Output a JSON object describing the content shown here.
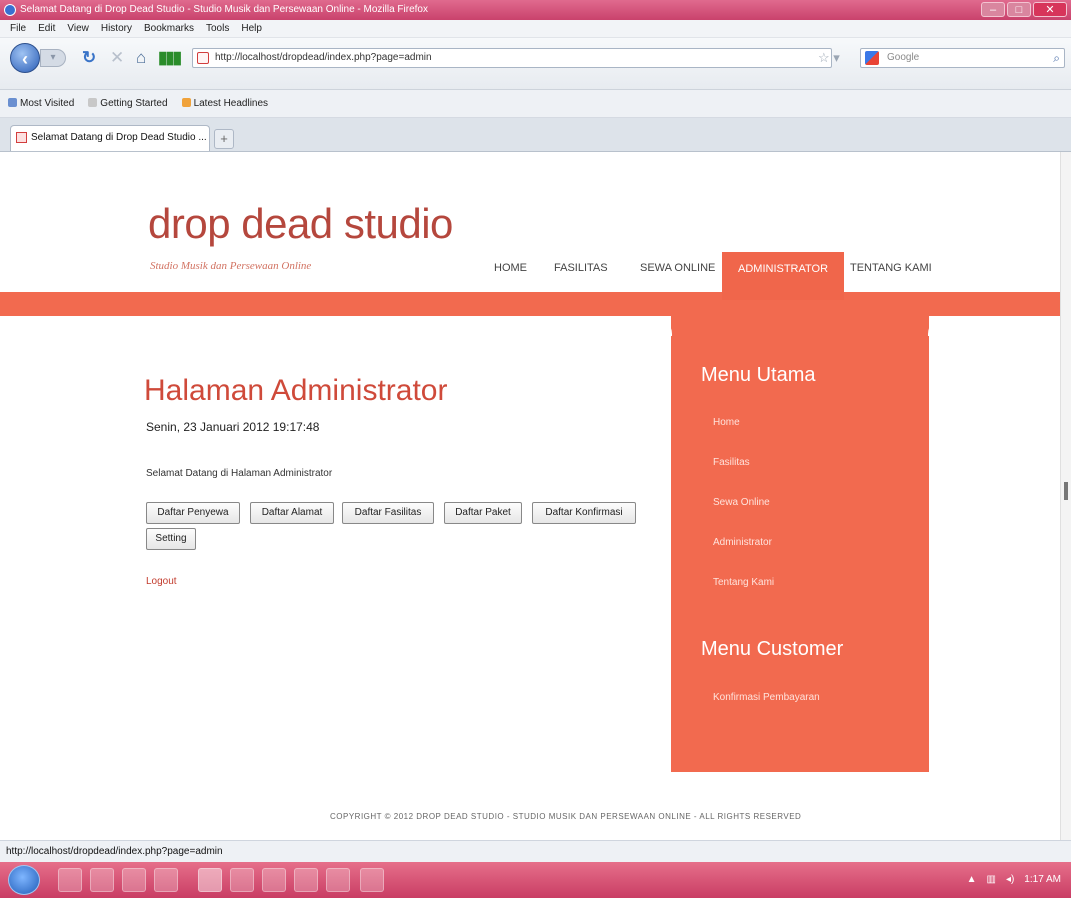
{
  "browser": {
    "window_title": "Selamat Datang di Drop Dead Studio - Studio Musik dan Persewaan Online - Mozilla Firefox",
    "menu": [
      "File",
      "Edit",
      "View",
      "History",
      "Bookmarks",
      "Tools",
      "Help"
    ],
    "url": "http://localhost/dropdead/index.php?page=admin",
    "search_placeholder": "Google",
    "bookmarks": [
      "Most Visited",
      "Getting Started",
      "Latest Headlines"
    ],
    "tab_title": "Selamat Datang di Drop Dead Studio ...",
    "new_tab": "+",
    "status_url": "http://localhost/dropdead/index.php?page=admin",
    "clock": "1:17 AM"
  },
  "site": {
    "title": "drop dead studio",
    "tagline": "Studio Musik dan Persewaan Online",
    "nav": [
      "HOME",
      "FASILITAS",
      "SEWA ONLINE",
      "ADMINISTRATOR",
      "TENTANG KAMI"
    ],
    "active_nav": "ADMINISTRATOR"
  },
  "main": {
    "heading": "Halaman Administrator",
    "date": "Senin, 23 Januari 2012 19:17:48",
    "welcome": "Selamat Datang di Halaman Administrator",
    "buttons": [
      "Daftar Penyewa",
      "Daftar Alamat",
      "Daftar Fasilitas",
      "Daftar Paket",
      "Daftar Konfirmasi",
      "Setting"
    ],
    "logout": "Logout"
  },
  "sidebar": {
    "main_heading": "Menu Utama",
    "main_links": [
      "Home",
      "Fasilitas",
      "Sewa Online",
      "Administrator",
      "Tentang Kami"
    ],
    "customer_heading": "Menu Customer",
    "customer_links": [
      "Konfirmasi Pembayaran"
    ]
  },
  "footer": {
    "text": "COPYRIGHT © 2012 DROP DEAD STUDIO - STUDIO MUSIK DAN PERSEWAAN ONLINE - ALL RIGHTS RESERVED"
  },
  "colors": {
    "accent": "#f26a4f",
    "title": "#b5473d",
    "heading": "#cf4a3a"
  }
}
